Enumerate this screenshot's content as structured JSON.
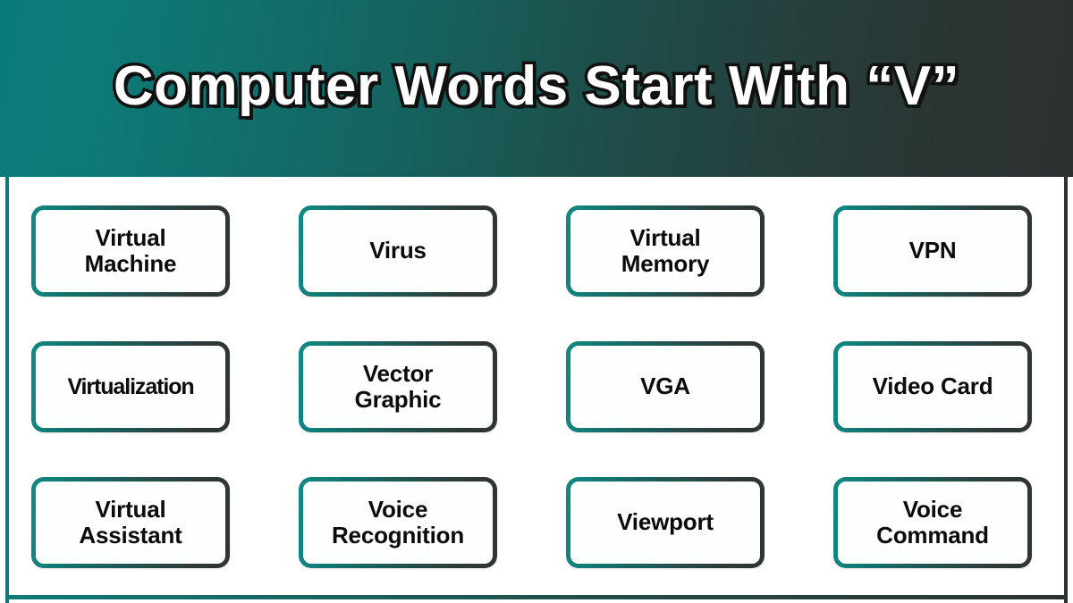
{
  "header": {
    "title": "Computer Words Start With “V”",
    "gradient_start": "#0a7a78",
    "gradient_end": "#2c3231"
  },
  "theme": {
    "accent_teal": "#0e7a77",
    "accent_dark": "#2b3231",
    "panel_background": "#ffffff",
    "text_color": "#0b0b0b"
  },
  "grid": {
    "columns": 4,
    "rows": 3,
    "items": [
      {
        "label": "Virtual\nMachine",
        "name": "virtual-machine"
      },
      {
        "label": "Virus",
        "name": "virus"
      },
      {
        "label": "Virtual\nMemory",
        "name": "virtual-memory"
      },
      {
        "label": "VPN",
        "name": "vpn"
      },
      {
        "label": "Virtualization",
        "name": "virtualization"
      },
      {
        "label": "Vector\nGraphic",
        "name": "vector-graphic"
      },
      {
        "label": "VGA",
        "name": "vga"
      },
      {
        "label": "Video Card",
        "name": "video-card"
      },
      {
        "label": "Virtual\nAssistant",
        "name": "virtual-assistant"
      },
      {
        "label": "Voice\nRecognition",
        "name": "voice-recognition"
      },
      {
        "label": "Viewport",
        "name": "viewport"
      },
      {
        "label": "Voice\nCommand",
        "name": "voice-command"
      }
    ]
  }
}
